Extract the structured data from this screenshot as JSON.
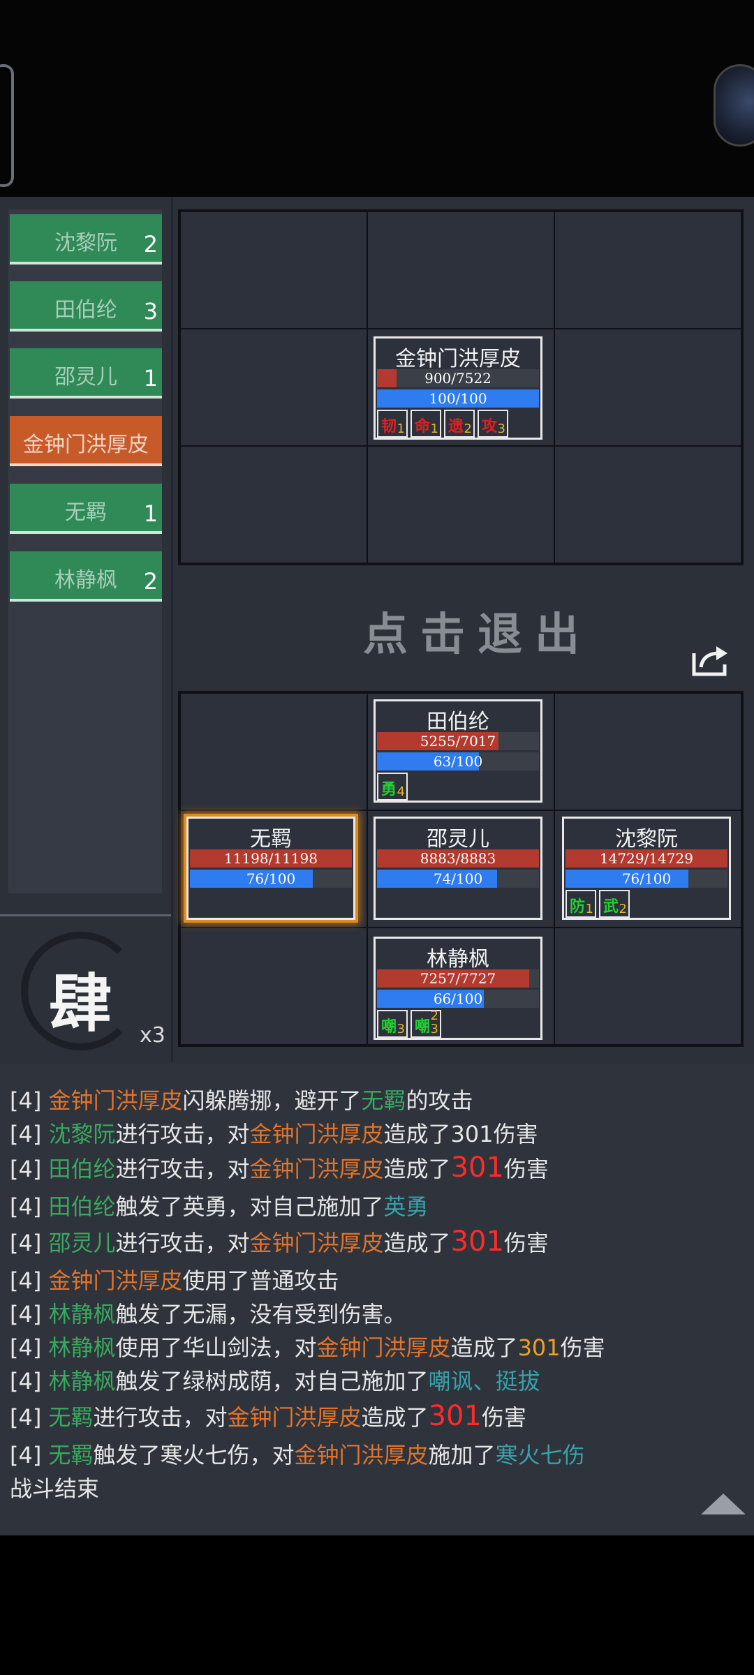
{
  "sidebar": {
    "characters": [
      {
        "name": "沈黎阮",
        "count": "2",
        "active": false
      },
      {
        "name": "田伯纶",
        "count": "3",
        "active": false
      },
      {
        "name": "邵灵儿",
        "count": "1",
        "active": false
      },
      {
        "name": "金钟门洪厚皮",
        "count": "",
        "active": true
      },
      {
        "name": "无羁",
        "count": "1",
        "active": false
      },
      {
        "name": "林静枫",
        "count": "2",
        "active": false
      }
    ],
    "speed_char": "肆",
    "speed_multiplier": "x3"
  },
  "enemy_unit": {
    "name": "金钟门洪厚皮",
    "hp_text": "900/7522",
    "hp_fraction": 0.12,
    "mp_text": "100/100",
    "mp_fraction": 1.0,
    "buffs": [
      {
        "char": "韧",
        "stack": "1",
        "color": "#e02020"
      },
      {
        "char": "命",
        "stack": "1",
        "color": "#e02020"
      },
      {
        "char": "遗",
        "stack": "2",
        "color": "#e02020"
      },
      {
        "char": "攻",
        "stack": "3",
        "color": "#e02020"
      }
    ]
  },
  "exit_label": "点击退出",
  "ally_units": {
    "tian": {
      "name": "田伯纶",
      "hp_text": "5255/7017",
      "hp_fraction": 0.75,
      "mp_text": "63/100",
      "mp_fraction": 0.63,
      "buffs": [
        {
          "char": "勇",
          "stack": "4",
          "color": "#22d030"
        }
      ]
    },
    "wuji": {
      "name": "无羁",
      "hp_text": "11198/11198",
      "hp_fraction": 1.0,
      "mp_text": "76/100",
      "mp_fraction": 0.76,
      "buffs": []
    },
    "shao": {
      "name": "邵灵儿",
      "hp_text": "8883/8883",
      "hp_fraction": 1.0,
      "mp_text": "74/100",
      "mp_fraction": 0.74,
      "buffs": []
    },
    "shen": {
      "name": "沈黎阮",
      "hp_text": "14729/14729",
      "hp_fraction": 1.0,
      "mp_text": "76/100",
      "mp_fraction": 0.76,
      "buffs": [
        {
          "char": "防",
          "stack": "1",
          "color": "#22d030"
        },
        {
          "char": "武",
          "stack": "2",
          "color": "#22d030"
        }
      ]
    },
    "lin": {
      "name": "林静枫",
      "hp_text": "7257/7727",
      "hp_fraction": 0.94,
      "mp_text": "66/100",
      "mp_fraction": 0.66,
      "buffs": [
        {
          "char": "嘲",
          "stack": "3",
          "color": "#22d030"
        },
        {
          "char": "嘲",
          "stack": "3",
          "stack_top": "2",
          "color": "#22d030"
        }
      ]
    }
  },
  "log": {
    "l1": {
      "p": "[4] ",
      "a": "金钟门洪厚皮",
      "b": "闪躲腾挪，避开了",
      "c": "无羁",
      "d": "的攻击"
    },
    "l2": {
      "p": "[4] ",
      "a": "沈黎阮",
      "b": "进行攻击，对",
      "c": "金钟门洪厚皮",
      "d": "造成了301伤害"
    },
    "l3": {
      "p": "[4] ",
      "a": "田伯纶",
      "b": "进行攻击，对",
      "c": "金钟门洪厚皮",
      "d": "造成了",
      "e": "301",
      "f": "伤害"
    },
    "l4": {
      "p": "[4] ",
      "a": "田伯纶",
      "b": "触发了英勇，对自己施加了",
      "c": "英勇"
    },
    "l5": {
      "p": "[4] ",
      "a": "邵灵儿",
      "b": "进行攻击，对",
      "c": "金钟门洪厚皮",
      "d": "造成了",
      "e": "301",
      "f": "伤害"
    },
    "l6": {
      "p": "[4] ",
      "a": "金钟门洪厚皮",
      "b": "使用了普通攻击"
    },
    "l7": {
      "p": "[4] ",
      "a": "林静枫",
      "b": "触发了无漏，没有受到伤害。"
    },
    "l8": {
      "p": "[4] ",
      "a": "林静枫",
      "b": "使用了华山剑法，对",
      "c": "金钟门洪厚皮",
      "d": "造成了",
      "e": "301",
      "f": "伤害"
    },
    "l9": {
      "p": "[4] ",
      "a": "林静枫",
      "b": "触发了绿树成荫，对自己施加了",
      "c": "嘲讽、挺拔"
    },
    "l10": {
      "p": "[4] ",
      "a": "无羁",
      "b": "进行攻击，对",
      "c": "金钟门洪厚皮",
      "d": "造成了",
      "e": "301",
      "f": "伤害"
    },
    "l11": {
      "p": "[4] ",
      "a": "无羁",
      "b": "触发了寒火七伤，对",
      "c": "金钟门洪厚皮",
      "d": "施加了",
      "e": "寒火七伤"
    },
    "l12": {
      "p": "战斗结束"
    }
  }
}
